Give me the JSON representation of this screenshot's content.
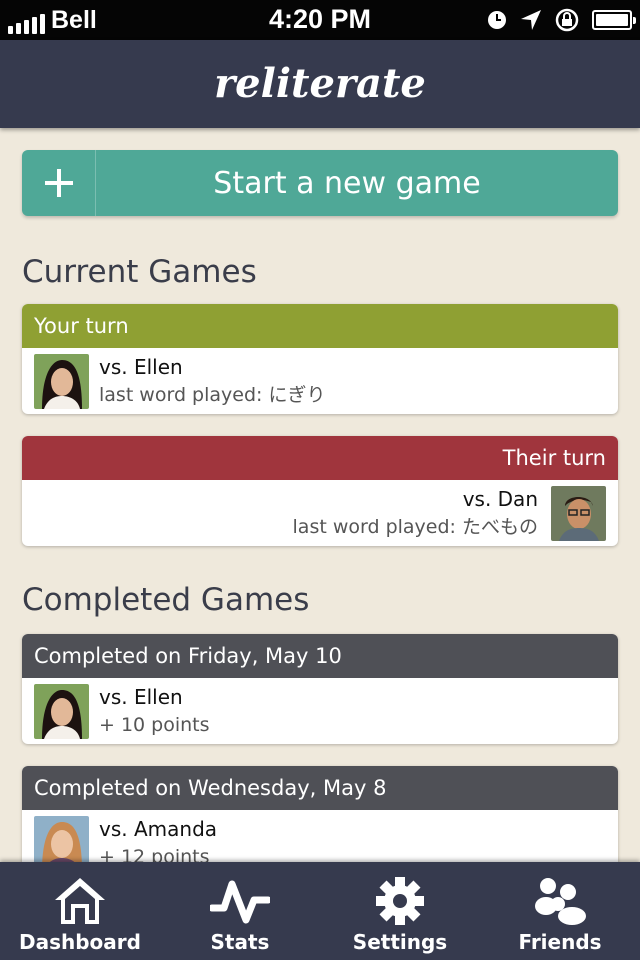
{
  "status_bar": {
    "carrier": "Bell",
    "time": "4:20 PM"
  },
  "nav": {
    "title": "reliterate"
  },
  "new_game": {
    "label": "Start a new game"
  },
  "current_games": {
    "title": "Current Games",
    "games": [
      {
        "header": "Your turn",
        "opponent": "vs. Ellen",
        "detail": "last word played: にぎり"
      },
      {
        "header": "Their turn",
        "opponent": "vs. Dan",
        "detail": "last word played: たべもの"
      }
    ]
  },
  "completed_games": {
    "title": "Completed Games",
    "games": [
      {
        "header": "Completed on Friday, May 10",
        "opponent": "vs. Ellen",
        "detail": "+ 10 points"
      },
      {
        "header": "Completed on Wednesday, May 8",
        "opponent": "vs. Amanda",
        "detail": "+ 12 points"
      }
    ]
  },
  "tabs": [
    {
      "label": "Dashboard",
      "icon": "home-icon"
    },
    {
      "label": "Stats",
      "icon": "pulse-icon"
    },
    {
      "label": "Settings",
      "icon": "gear-icon"
    },
    {
      "label": "Friends",
      "icon": "friends-icon"
    }
  ],
  "colors": {
    "accent_green_teal": "#4fa897",
    "your_turn": "#8fa033",
    "their_turn": "#a0353d",
    "completed": "#4f5056",
    "bars": "#363a4e"
  }
}
